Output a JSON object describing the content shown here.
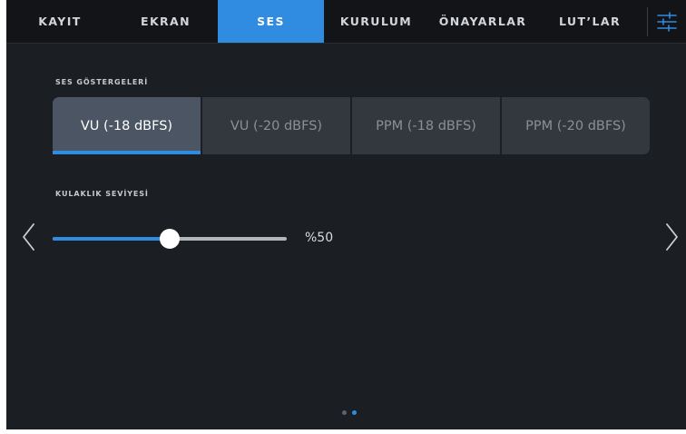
{
  "tabs": [
    {
      "label": "KAYIT",
      "active": false
    },
    {
      "label": "EKRAN",
      "active": false
    },
    {
      "label": "SES",
      "active": true
    },
    {
      "label": "KURULUM",
      "active": false
    },
    {
      "label": "ÖNAYARLAR",
      "active": false
    },
    {
      "label": "LUT’LAR",
      "active": false
    }
  ],
  "audio_meters": {
    "label": "SES GÖSTERGELERİ",
    "options": [
      "VU (-18 dBFS)",
      "VU (-20 dBFS)",
      "PPM (-18 dBFS)",
      "PPM (-20 dBFS)"
    ],
    "selected": "VU (-18 dBFS)"
  },
  "headphone_level": {
    "label": "KULAKLIK SEVİYESİ",
    "value_text": "%50",
    "value": 0.5
  },
  "pagination": {
    "total": 2,
    "current": 2
  },
  "icons": {
    "settings": "sliders-settings-icon",
    "previous": "chevron-left-icon",
    "next": "chevron-right-icon"
  },
  "colors": {
    "accent": "#2f8ce0",
    "background": "#1b1e22",
    "tabbar": "#121417",
    "segment": "#33383f",
    "segment_active": "#4b5563"
  }
}
